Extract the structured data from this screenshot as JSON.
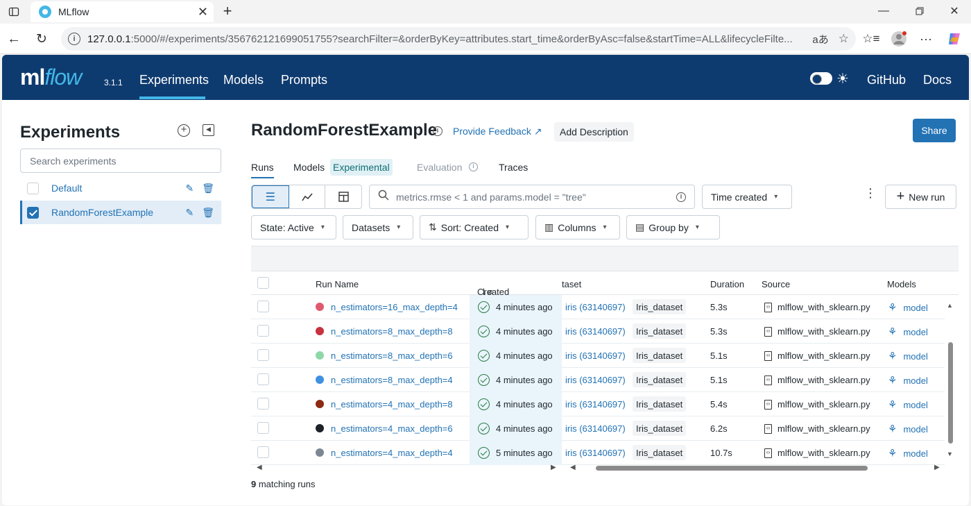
{
  "browser": {
    "tab_title": "MLflow",
    "url_host": "127.0.0.1",
    "url_path": ":5000/#/experiments/356762121699051755?searchFilter=&orderByKey=attributes.start_time&orderByAsc=false&startTime=ALL&lifecycleFilte...",
    "read_aloud": "aあ"
  },
  "header": {
    "logo_ml": "ml",
    "logo_flow": "flow",
    "version": "3.1.1",
    "nav": [
      "Experiments",
      "Models",
      "Prompts"
    ],
    "github": "GitHub",
    "docs": "Docs"
  },
  "sidebar": {
    "title": "Experiments",
    "search_placeholder": "Search experiments",
    "items": [
      {
        "label": "Default",
        "checked": false
      },
      {
        "label": "RandomForestExample",
        "checked": true
      }
    ]
  },
  "experiment": {
    "title": "RandomForestExample",
    "feedback": "Provide Feedback",
    "add_description": "Add Description",
    "share": "Share"
  },
  "tabs": {
    "runs": "Runs",
    "models": "Models",
    "experimental": "Experimental",
    "evaluation": "Evaluation",
    "traces": "Traces"
  },
  "toolbar": {
    "search_value": "metrics.rmse < 1 and params.model = \"tree\"",
    "time_created": "Time created",
    "new_run": "New run",
    "state": "State: Active",
    "datasets": "Datasets",
    "sort": "Sort: Created",
    "columns": "Columns",
    "group_by": "Group by"
  },
  "table": {
    "columns": {
      "run_name": "Run Name",
      "created": "Created",
      "dataset": "taset",
      "duration": "Duration",
      "source": "Source",
      "models": "Models"
    },
    "rows": [
      {
        "name": "n_estimators=16_max_depth=4",
        "color": "#e05a6d",
        "created": "4 minutes ago",
        "dataset": "iris (63140697)",
        "dataset_tag": "Iris_dataset",
        "duration": "5.3s",
        "source": "mlflow_with_sklearn.py",
        "model": "model"
      },
      {
        "name": "n_estimators=8_max_depth=8",
        "color": "#c83140",
        "created": "4 minutes ago",
        "dataset": "iris (63140697)",
        "dataset_tag": "Iris_dataset",
        "duration": "5.3s",
        "source": "mlflow_with_sklearn.py",
        "model": "model"
      },
      {
        "name": "n_estimators=8_max_depth=6",
        "color": "#8ed8a7",
        "created": "4 minutes ago",
        "dataset": "iris (63140697)",
        "dataset_tag": "Iris_dataset",
        "duration": "5.1s",
        "source": "mlflow_with_sklearn.py",
        "model": "model"
      },
      {
        "name": "n_estimators=8_max_depth=4",
        "color": "#3f91e0",
        "created": "4 minutes ago",
        "dataset": "iris (63140697)",
        "dataset_tag": "Iris_dataset",
        "duration": "5.1s",
        "source": "mlflow_with_sklearn.py",
        "model": "model"
      },
      {
        "name": "n_estimators=4_max_depth=8",
        "color": "#8c2a12",
        "created": "4 minutes ago",
        "dataset": "iris (63140697)",
        "dataset_tag": "Iris_dataset",
        "duration": "5.4s",
        "source": "mlflow_with_sklearn.py",
        "model": "model"
      },
      {
        "name": "n_estimators=4_max_depth=6",
        "color": "#1c2226",
        "created": "4 minutes ago",
        "dataset": "iris (63140697)",
        "dataset_tag": "Iris_dataset",
        "duration": "6.2s",
        "source": "mlflow_with_sklearn.py",
        "model": "model"
      },
      {
        "name": "n_estimators=4_max_depth=4",
        "color": "#7b8893",
        "created": "5 minutes ago",
        "dataset": "iris (63140697)",
        "dataset_tag": "Iris_dataset",
        "duration": "10.7s",
        "source": "mlflow_with_sklearn.py",
        "model": "model"
      }
    ]
  },
  "footer": {
    "count": "9",
    "count_label": " matching runs"
  },
  "colors": {
    "brand_navy": "#0e3b6f",
    "accent_blue": "#2272b4",
    "flow_cyan": "#43b7e8"
  }
}
